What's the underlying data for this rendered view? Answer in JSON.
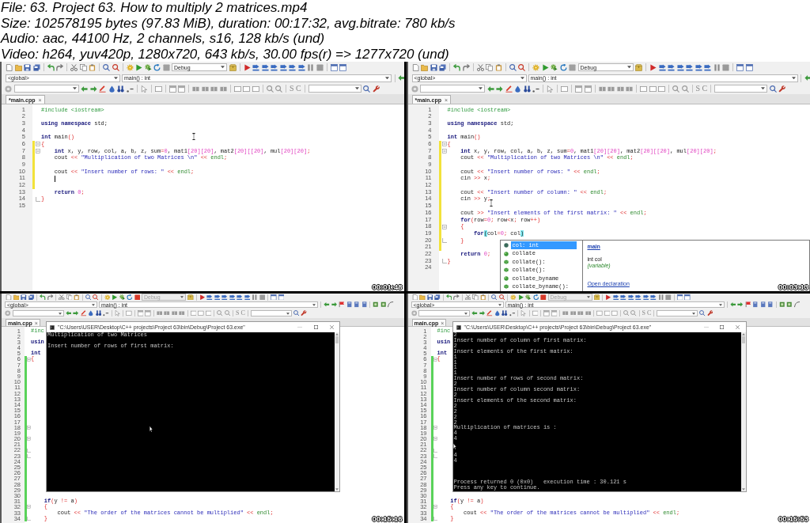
{
  "file_info": [
    "File: 63. Project 63. How to multiply 2 matrices.mp4",
    "Size: 102578195 bytes (97.83 MiB), duration: 00:17:32, avg.bitrate: 780 kb/s",
    "Audio: aac, 44100 Hz, 2 channels, s16, 128 kb/s (und)",
    "Video: h264, yuv420p, 1280x720, 643 kb/s, 30.00 fps(r) => 1277x720 (und)"
  ],
  "thumbnails": [
    {
      "timestamp": "00:01:48",
      "running": false,
      "pointer": {
        "kind": "i-beam"
      },
      "build_target": "Debug",
      "scope": "<global>",
      "symbol": "main() : int",
      "search_toggles": [
        "S",
        "C"
      ],
      "tab": {
        "label": "*main.cpp",
        "close": "×"
      },
      "editor": {
        "lines": [
          {
            "number": "1",
            "caret": false,
            "segments": [
              {
                "text": "#include <iostream>",
                "kind": "preprocessor"
              }
            ]
          },
          {
            "number": "2",
            "caret": false
          },
          {
            "number": "3",
            "caret": false,
            "segments": [
              {
                "text": "using namespace",
                "kind": "keyword"
              },
              {
                "text": " std;",
                "kind": "plain"
              }
            ]
          },
          {
            "number": "4",
            "caret": false
          },
          {
            "number": "5",
            "caret": false,
            "segments": [
              {
                "text": "int",
                "kind": "keyword"
              },
              {
                "text": " main",
                "kind": "plain"
              },
              {
                "text": "()",
                "kind": "operator"
              }
            ]
          },
          {
            "number": "6",
            "caret": false,
            "change": {
              "kind": "unsaved"
            },
            "fold": {
              "kind": "start"
            },
            "segments": [
              {
                "text": "{",
                "kind": "operator"
              }
            ]
          },
          {
            "number": "7",
            "caret": false,
            "change": {
              "kind": "unsaved"
            },
            "fold": {
              "kind": "start"
            },
            "segments": [
              {
                "text": "    int",
                "kind": "keyword"
              },
              {
                "text": " x, y, row, col, a, b, z, sum",
                "kind": "plain"
              },
              {
                "text": "=",
                "kind": "operator"
              },
              {
                "text": "0",
                "kind": "number"
              },
              {
                "text": ", mat1",
                "kind": "plain"
              },
              {
                "text": "[20][20]",
                "kind": "number"
              },
              {
                "text": ", mat2",
                "kind": "plain"
              },
              {
                "text": "[20][[20]",
                "kind": "number"
              },
              {
                "text": ", mul",
                "kind": "plain"
              },
              {
                "text": "[20][20]",
                "kind": "number"
              },
              {
                "text": ";",
                "kind": "operator"
              }
            ]
          },
          {
            "number": "8",
            "caret": false,
            "change": {
              "kind": "unsaved"
            },
            "segments": [
              {
                "text": "    cout ",
                "kind": "plain"
              },
              {
                "text": "<<",
                "kind": "operator"
              },
              {
                "text": " \"Multiplication of two Matrices \\n\"",
                "kind": "string"
              },
              {
                "text": " <<",
                "kind": "operator"
              },
              {
                "text": " endl",
                "kind": "library"
              },
              {
                "text": ";",
                "kind": "operator"
              }
            ]
          },
          {
            "number": "9",
            "caret": false,
            "change": {
              "kind": "unsaved"
            }
          },
          {
            "number": "10",
            "caret": false,
            "change": {
              "kind": "unsaved"
            },
            "segments": [
              {
                "text": "    cout ",
                "kind": "plain"
              },
              {
                "text": "<<",
                "kind": "operator"
              },
              {
                "text": " \"Insert number of rows: \"",
                "kind": "string"
              },
              {
                "text": " <<",
                "kind": "operator"
              },
              {
                "text": " endl",
                "kind": "library"
              },
              {
                "text": ";",
                "kind": "operator"
              }
            ]
          },
          {
            "number": "11",
            "caret": true,
            "change": {
              "kind": "unsaved"
            }
          },
          {
            "number": "12",
            "caret": false,
            "change": {
              "kind": "unsaved"
            }
          },
          {
            "number": "13",
            "caret": false,
            "segments": [
              {
                "text": "    return",
                "kind": "keyword"
              },
              {
                "text": " 0",
                "kind": "number"
              },
              {
                "text": ";",
                "kind": "operator"
              }
            ]
          },
          {
            "number": "14",
            "caret": false,
            "fold": {
              "kind": "end"
            },
            "segments": [
              {
                "text": "}",
                "kind": "operator"
              }
            ]
          },
          {
            "number": "15",
            "caret": false
          }
        ]
      }
    },
    {
      "timestamp": "00:03:13",
      "running": false,
      "pointer": {
        "kind": "i-beam"
      },
      "build_target": "Debug",
      "scope": "<global>",
      "symbol": "main() : int",
      "search_toggles": [
        "S",
        "C"
      ],
      "tab": {
        "label": "*main.cpp",
        "close": "×"
      },
      "editor": {
        "lines": [
          {
            "number": "1",
            "segments": [
              {
                "text": "#include <iostream>",
                "kind": "preprocessor"
              }
            ]
          },
          {
            "number": "2"
          },
          {
            "number": "3",
            "segments": [
              {
                "text": "using namespace",
                "kind": "keyword"
              },
              {
                "text": " std;",
                "kind": "plain"
              }
            ]
          },
          {
            "number": "4"
          },
          {
            "number": "5",
            "segments": [
              {
                "text": "int",
                "kind": "keyword"
              },
              {
                "text": " main",
                "kind": "plain"
              },
              {
                "text": "()",
                "kind": "operator"
              }
            ]
          },
          {
            "number": "6",
            "change": {
              "kind": "unsaved"
            },
            "fold": {
              "kind": "start"
            },
            "segments": [
              {
                "text": "{",
                "kind": "operator"
              }
            ]
          },
          {
            "number": "7",
            "change": {
              "kind": "unsaved"
            },
            "fold": {
              "kind": "start"
            },
            "segments": [
              {
                "text": "    int",
                "kind": "keyword"
              },
              {
                "text": " x, y, row, col, a, b, z, sum",
                "kind": "plain"
              },
              {
                "text": "=",
                "kind": "operator"
              },
              {
                "text": "0",
                "kind": "number"
              },
              {
                "text": ", mat1",
                "kind": "plain"
              },
              {
                "text": "[20][20]",
                "kind": "number"
              },
              {
                "text": ", mat2",
                "kind": "plain"
              },
              {
                "text": "[20][[20]",
                "kind": "number"
              },
              {
                "text": ", mul",
                "kind": "plain"
              },
              {
                "text": "[20][20]",
                "kind": "number"
              },
              {
                "text": ";",
                "kind": "operator"
              }
            ]
          },
          {
            "number": "8",
            "change": {
              "kind": "unsaved"
            },
            "segments": [
              {
                "text": "    cout ",
                "kind": "plain"
              },
              {
                "text": "<<",
                "kind": "operator"
              },
              {
                "text": " \"Multiplication of two Matrices \\n\"",
                "kind": "string"
              },
              {
                "text": " <<",
                "kind": "operator"
              },
              {
                "text": " endl",
                "kind": "library"
              },
              {
                "text": ";",
                "kind": "operator"
              }
            ]
          },
          {
            "number": "9",
            "change": {
              "kind": "unsaved"
            }
          },
          {
            "number": "10",
            "change": {
              "kind": "unsaved"
            },
            "segments": [
              {
                "text": "    cout ",
                "kind": "plain"
              },
              {
                "text": "<<",
                "kind": "operator"
              },
              {
                "text": " \"Insert number of rows: \"",
                "kind": "string"
              },
              {
                "text": " <<",
                "kind": "operator"
              },
              {
                "text": " endl",
                "kind": "library"
              },
              {
                "text": ";",
                "kind": "operator"
              }
            ]
          },
          {
            "number": "11",
            "change": {
              "kind": "unsaved"
            },
            "segments": [
              {
                "text": "    cin ",
                "kind": "plain"
              },
              {
                "text": ">>",
                "kind": "operator"
              },
              {
                "text": " x",
                "kind": "plain"
              },
              {
                "text": ";",
                "kind": "operator"
              }
            ]
          },
          {
            "number": "12",
            "change": {
              "kind": "unsaved"
            }
          },
          {
            "number": "13",
            "change": {
              "kind": "unsaved"
            },
            "segments": [
              {
                "text": "    cout ",
                "kind": "plain"
              },
              {
                "text": "<<",
                "kind": "operator"
              },
              {
                "text": " \"Insert number of column: \"",
                "kind": "string"
              },
              {
                "text": " <<",
                "kind": "operator"
              },
              {
                "text": " endl",
                "kind": "library"
              },
              {
                "text": ";",
                "kind": "operator"
              }
            ]
          },
          {
            "number": "14",
            "change": {
              "kind": "unsaved"
            },
            "segments": [
              {
                "text": "    cin ",
                "kind": "plain"
              },
              {
                "text": ">>",
                "kind": "operator"
              },
              {
                "text": " y",
                "kind": "plain"
              },
              {
                "text": ";",
                "kind": "operator"
              }
            ]
          },
          {
            "number": "15",
            "change": {
              "kind": "unsaved"
            }
          },
          {
            "number": "16",
            "change": {
              "kind": "unsaved"
            },
            "segments": [
              {
                "text": "    cout ",
                "kind": "plain"
              },
              {
                "text": ">>",
                "kind": "operator"
              },
              {
                "text": " \"Insert elements of the first matrix: \"",
                "kind": "string"
              },
              {
                "text": " <<",
                "kind": "operator"
              },
              {
                "text": " endl",
                "kind": "library"
              },
              {
                "text": ";",
                "kind": "operator"
              }
            ]
          },
          {
            "number": "17",
            "change": {
              "kind": "unsaved"
            },
            "segments": [
              {
                "text": "    for",
                "kind": "keyword"
              },
              {
                "text": "(",
                "kind": "operator"
              },
              {
                "text": "row",
                "kind": "plain"
              },
              {
                "text": "=",
                "kind": "operator"
              },
              {
                "text": "0",
                "kind": "number"
              },
              {
                "text": ";",
                "kind": "operator"
              },
              {
                "text": " row",
                "kind": "plain"
              },
              {
                "text": "<",
                "kind": "operator"
              },
              {
                "text": "x",
                "kind": "plain"
              },
              {
                "text": ";",
                "kind": "operator"
              },
              {
                "text": " row",
                "kind": "plain"
              },
              {
                "text": "++)",
                "kind": "operator"
              }
            ]
          },
          {
            "number": "18",
            "change": {
              "kind": "unsaved"
            },
            "fold": {
              "kind": "start"
            },
            "segments": [
              {
                "text": "    {",
                "kind": "operator"
              }
            ]
          },
          {
            "number": "19",
            "change": {
              "kind": "unsaved"
            },
            "segments": [
              {
                "text": "        for",
                "kind": "keyword"
              },
              {
                "text": "(",
                "kind": "match"
              },
              {
                "text": "col",
                "kind": "plain"
              },
              {
                "text": "=",
                "kind": "operator"
              },
              {
                "text": "0",
                "kind": "number"
              },
              {
                "text": ";",
                "kind": "operator"
              },
              {
                "text": " col",
                "kind": "plain"
              },
              {
                "text": ")",
                "kind": "match"
              }
            ]
          },
          {
            "number": "20",
            "change": {
              "kind": "unsaved"
            },
            "fold": {
              "kind": "end"
            },
            "segments": [
              {
                "text": "    }",
                "kind": "operator"
              }
            ]
          },
          {
            "number": "21",
            "change": {
              "kind": "unsaved"
            }
          },
          {
            "number": "22",
            "segments": [
              {
                "text": "    return",
                "kind": "keyword"
              },
              {
                "text": " 0",
                "kind": "number"
              },
              {
                "text": ";",
                "kind": "operator"
              }
            ]
          },
          {
            "number": "23",
            "fold": {
              "kind": "end"
            },
            "segments": [
              {
                "text": "}",
                "kind": "operator"
              }
            ]
          },
          {
            "number": "24"
          }
        ]
      },
      "autocomplete": {
        "items": [
          {
            "label": "col: int",
            "kind": "variable",
            "selected": true
          },
          {
            "label": "collate",
            "kind": "class",
            "selected": false
          },
          {
            "label": "collate():",
            "kind": "function",
            "selected": false
          },
          {
            "label": "collate():",
            "kind": "function",
            "selected": false
          },
          {
            "label": "collate_byname",
            "kind": "class",
            "selected": false
          },
          {
            "label": "collate_byname():",
            "kind": "function",
            "selected": false
          }
        ],
        "details": {
          "scope_link": "main",
          "declaration": "int col",
          "category": "(variable)",
          "link": "Open declaration"
        }
      }
    },
    {
      "timestamp": "00:15:16",
      "running": true,
      "pointer": {
        "kind": "arrow"
      },
      "build_target": "Debug",
      "scope": "<global>",
      "symbol": "main() : int",
      "search_toggles": [
        "S",
        "C"
      ],
      "tab": {
        "label": "main.cpp",
        "close": "×"
      },
      "editor": {
        "lines": [
          {
            "number": "1",
            "segments": [
              {
                "text": "#inc",
                "kind": "preprocessor"
              }
            ]
          },
          {
            "number": "2"
          },
          {
            "number": "3",
            "segments": [
              {
                "text": "usin",
                "kind": "keyword"
              }
            ]
          },
          {
            "number": "4"
          },
          {
            "number": "5",
            "segments": [
              {
                "text": "int",
                "kind": "keyword"
              }
            ]
          },
          {
            "number": "6",
            "change": {
              "kind": "saved"
            },
            "fold": {
              "kind": "start"
            },
            "segments": [
              {
                "text": "{",
                "kind": "operator"
              }
            ]
          },
          {
            "number": "7",
            "change": {
              "kind": "saved"
            }
          },
          {
            "number": "8",
            "change": {
              "kind": "saved"
            }
          },
          {
            "number": "9",
            "change": {
              "kind": "saved"
            }
          },
          {
            "number": "10",
            "change": {
              "kind": "saved"
            }
          },
          {
            "number": "11",
            "change": {
              "kind": "saved"
            }
          },
          {
            "number": "12",
            "change": {
              "kind": "saved"
            }
          },
          {
            "number": "13",
            "change": {
              "kind": "saved"
            }
          },
          {
            "number": "14",
            "change": {
              "kind": "saved"
            }
          },
          {
            "number": "15",
            "change": {
              "kind": "saved"
            }
          },
          {
            "number": "16",
            "change": {
              "kind": "saved"
            }
          },
          {
            "number": "17",
            "change": {
              "kind": "saved"
            }
          },
          {
            "number": "18",
            "change": {
              "kind": "saved"
            },
            "fold": {
              "kind": "start"
            }
          },
          {
            "number": "19",
            "change": {
              "kind": "saved"
            }
          },
          {
            "number": "20",
            "change": {
              "kind": "saved"
            },
            "fold": {
              "kind": "start"
            }
          },
          {
            "number": "21",
            "change": {
              "kind": "saved"
            }
          },
          {
            "number": "22",
            "change": {
              "kind": "saved"
            },
            "fold": {
              "kind": "end"
            }
          },
          {
            "number": "23",
            "change": {
              "kind": "saved"
            },
            "fold": {
              "kind": "end"
            }
          },
          {
            "number": "24",
            "change": {
              "kind": "saved"
            }
          },
          {
            "number": "25",
            "change": {
              "kind": "saved"
            }
          },
          {
            "number": "26",
            "change": {
              "kind": "saved"
            }
          },
          {
            "number": "27",
            "change": {
              "kind": "saved"
            }
          },
          {
            "number": "28",
            "change": {
              "kind": "saved"
            }
          },
          {
            "number": "29",
            "change": {
              "kind": "saved"
            }
          },
          {
            "number": "30",
            "change": {
              "kind": "saved"
            }
          },
          {
            "number": "31",
            "change": {
              "kind": "saved"
            },
            "segments": [
              {
                "text": "    if",
                "kind": "keyword"
              },
              {
                "text": "(",
                "kind": "operator"
              },
              {
                "text": "y ",
                "kind": "plain"
              },
              {
                "text": "!=",
                "kind": "operator"
              },
              {
                "text": " a",
                "kind": "plain"
              },
              {
                "text": ")",
                "kind": "operator"
              }
            ]
          },
          {
            "number": "32",
            "change": {
              "kind": "saved"
            },
            "fold": {
              "kind": "start"
            },
            "segments": [
              {
                "text": "    {",
                "kind": "operator"
              }
            ]
          },
          {
            "number": "33",
            "change": {
              "kind": "saved"
            },
            "segments": [
              {
                "text": "        cout ",
                "kind": "plain"
              },
              {
                "text": "<<",
                "kind": "operator"
              },
              {
                "text": " \"The order of the matrices cannot be multiplied\"",
                "kind": "string"
              },
              {
                "text": " <<",
                "kind": "operator"
              },
              {
                "text": " endl",
                "kind": "library"
              },
              {
                "text": ";",
                "kind": "operator"
              }
            ]
          },
          {
            "number": "34",
            "change": {
              "kind": "saved"
            },
            "fold": {
              "kind": "end"
            },
            "segments": [
              {
                "text": "    }",
                "kind": "operator"
              }
            ]
          }
        ]
      },
      "console": {
        "title": "\"C:\\Users\\USER\\Desktop\\C++ projects\\Project 63\\bin\\Debug\\Project 63.exe\"",
        "lines": [
          {
            "kind": "text",
            "text": "Multiplication of two Matrices"
          },
          {
            "kind": "blank"
          },
          {
            "kind": "text",
            "text": "Insert number of rows of first matrix:"
          }
        ]
      }
    },
    {
      "timestamp": "00:15:53",
      "running": true,
      "pointer": {
        "kind": "arrow"
      },
      "build_target": "Debug",
      "scope": "<global>",
      "symbol": "main() : int",
      "search_toggles": [
        "S",
        "C"
      ],
      "tab": {
        "label": "main.cpp",
        "close": "×"
      },
      "editor": {
        "lines": [
          {
            "number": "1",
            "segments": [
              {
                "text": "#inc",
                "kind": "preprocessor"
              }
            ]
          },
          {
            "number": "2"
          },
          {
            "number": "3",
            "segments": [
              {
                "text": "usin",
                "kind": "keyword"
              }
            ]
          },
          {
            "number": "4"
          },
          {
            "number": "5",
            "segments": [
              {
                "text": "int",
                "kind": "keyword"
              }
            ]
          },
          {
            "number": "6",
            "change": {
              "kind": "saved"
            },
            "fold": {
              "kind": "start"
            },
            "segments": [
              {
                "text": "{",
                "kind": "operator"
              }
            ]
          },
          {
            "number": "7",
            "change": {
              "kind": "saved"
            }
          },
          {
            "number": "8",
            "change": {
              "kind": "saved"
            }
          },
          {
            "number": "9",
            "change": {
              "kind": "saved"
            }
          },
          {
            "number": "10",
            "change": {
              "kind": "saved"
            }
          },
          {
            "number": "11",
            "change": {
              "kind": "saved"
            }
          },
          {
            "number": "12",
            "change": {
              "kind": "saved"
            }
          },
          {
            "number": "13",
            "change": {
              "kind": "saved"
            }
          },
          {
            "number": "14",
            "change": {
              "kind": "saved"
            }
          },
          {
            "number": "15",
            "change": {
              "kind": "saved"
            }
          },
          {
            "number": "16",
            "change": {
              "kind": "saved"
            }
          },
          {
            "number": "17",
            "change": {
              "kind": "saved"
            }
          },
          {
            "number": "18",
            "change": {
              "kind": "saved"
            },
            "fold": {
              "kind": "start"
            }
          },
          {
            "number": "19",
            "change": {
              "kind": "saved"
            }
          },
          {
            "number": "20",
            "change": {
              "kind": "saved"
            },
            "fold": {
              "kind": "start"
            }
          },
          {
            "number": "21",
            "change": {
              "kind": "saved"
            }
          },
          {
            "number": "22",
            "change": {
              "kind": "saved"
            },
            "fold": {
              "kind": "end"
            }
          },
          {
            "number": "23",
            "change": {
              "kind": "saved"
            },
            "fold": {
              "kind": "end"
            }
          },
          {
            "number": "24",
            "change": {
              "kind": "saved"
            }
          },
          {
            "number": "25",
            "change": {
              "kind": "saved"
            }
          },
          {
            "number": "26",
            "change": {
              "kind": "saved"
            }
          },
          {
            "number": "27",
            "change": {
              "kind": "saved"
            }
          },
          {
            "number": "28",
            "change": {
              "kind": "saved"
            }
          },
          {
            "number": "29",
            "change": {
              "kind": "saved"
            }
          },
          {
            "number": "30",
            "change": {
              "kind": "saved"
            }
          },
          {
            "number": "31",
            "change": {
              "kind": "saved"
            },
            "segments": [
              {
                "text": "    if",
                "kind": "keyword"
              },
              {
                "text": "(",
                "kind": "operator"
              },
              {
                "text": "y ",
                "kind": "plain"
              },
              {
                "text": "!=",
                "kind": "operator"
              },
              {
                "text": " a",
                "kind": "plain"
              },
              {
                "text": ")",
                "kind": "operator"
              }
            ]
          },
          {
            "number": "32",
            "change": {
              "kind": "saved"
            },
            "fold": {
              "kind": "start"
            },
            "segments": [
              {
                "text": "    {",
                "kind": "operator"
              }
            ]
          },
          {
            "number": "33",
            "change": {
              "kind": "saved"
            },
            "segments": [
              {
                "text": "        cout ",
                "kind": "plain"
              },
              {
                "text": "<<",
                "kind": "operator"
              },
              {
                "text": " \"The order of the matrices cannot be multiplied\"",
                "kind": "string"
              },
              {
                "text": " <<",
                "kind": "operator"
              },
              {
                "text": " endl",
                "kind": "library"
              },
              {
                "text": ";",
                "kind": "operator"
              }
            ]
          },
          {
            "number": "34",
            "change": {
              "kind": "saved"
            },
            "fold": {
              "kind": "end"
            },
            "segments": [
              {
                "text": "    }",
                "kind": "operator"
              }
            ]
          }
        ]
      },
      "console": {
        "title": "\"C:\\Users\\USER\\Desktop\\C++ projects\\Project 63\\bin\\Debug\\Project 63.exe\"",
        "lines": [
          {
            "kind": "text",
            "text": "2"
          },
          {
            "kind": "text",
            "text": "Insert number of column of first matrix:"
          },
          {
            "kind": "text",
            "text": "2"
          },
          {
            "kind": "text",
            "text": "Insert elements of the first matrix:"
          },
          {
            "kind": "text",
            "text": "1"
          },
          {
            "kind": "text",
            "text": "1"
          },
          {
            "kind": "text",
            "text": "1"
          },
          {
            "kind": "text",
            "text": "1"
          },
          {
            "kind": "text",
            "text": "Insert number of rows of second matrix:"
          },
          {
            "kind": "text",
            "text": "2"
          },
          {
            "kind": "text",
            "text": "Insert number of column second matrix:"
          },
          {
            "kind": "text",
            "text": "2"
          },
          {
            "kind": "text",
            "text": "Insert elements of the second matrix:"
          },
          {
            "kind": "text",
            "text": "2"
          },
          {
            "kind": "text",
            "text": "2"
          },
          {
            "kind": "text",
            "text": "2"
          },
          {
            "kind": "text",
            "text": "2"
          },
          {
            "kind": "text",
            "text": "Multiplication of matrices is :"
          },
          {
            "kind": "text",
            "text": "4"
          },
          {
            "kind": "text",
            "text": "4"
          },
          {
            "kind": "blank"
          },
          {
            "kind": "blank"
          },
          {
            "kind": "text",
            "text": "4"
          },
          {
            "kind": "text",
            "text": "4"
          },
          {
            "kind": "blank"
          },
          {
            "kind": "blank"
          },
          {
            "kind": "blank"
          },
          {
            "kind": "text",
            "text": "Process returned 0 (0x0)   execution time : 30.121 s"
          },
          {
            "kind": "text",
            "text": "Press any key to continue."
          }
        ]
      }
    }
  ]
}
